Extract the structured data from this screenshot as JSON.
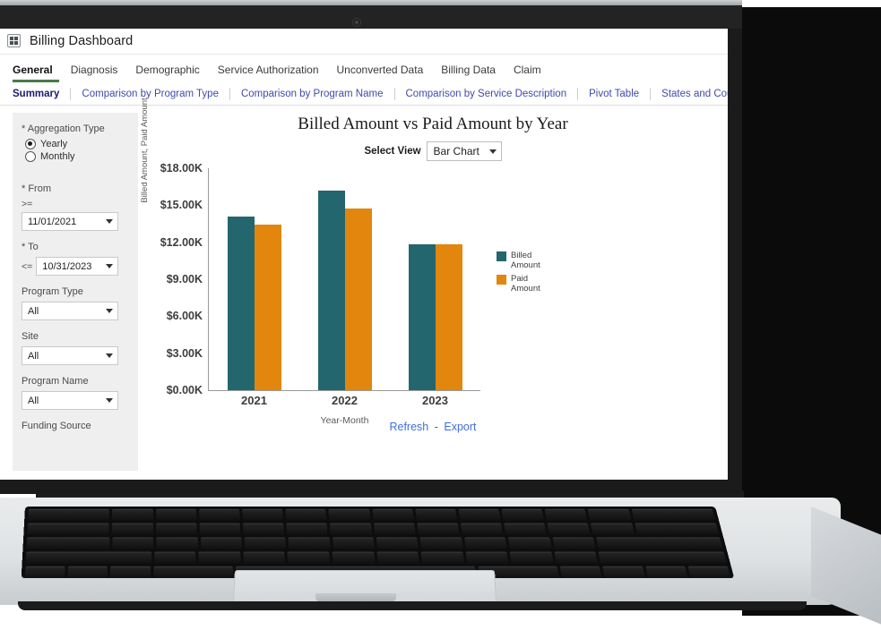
{
  "window": {
    "title": "Billing Dashboard",
    "app_icon": "grid-icon"
  },
  "primary_tabs": [
    {
      "label": "General",
      "active": true
    },
    {
      "label": "Diagnosis",
      "active": false
    },
    {
      "label": "Demographic",
      "active": false
    },
    {
      "label": "Service Authorization",
      "active": false
    },
    {
      "label": "Unconverted Data",
      "active": false
    },
    {
      "label": "Billing Data",
      "active": false
    },
    {
      "label": "Claim",
      "active": false
    }
  ],
  "secondary_tabs": [
    {
      "label": "Summary",
      "active": true
    },
    {
      "label": "Comparison by Program Type",
      "active": false
    },
    {
      "label": "Comparison by Program Name",
      "active": false
    },
    {
      "label": "Comparison by Service Description",
      "active": false
    },
    {
      "label": "Pivot Table",
      "active": false
    },
    {
      "label": "States and Counties",
      "active": false
    }
  ],
  "sidebar": {
    "aggregation": {
      "label": "* Aggregation Type",
      "options": [
        {
          "label": "Yearly",
          "selected": true
        },
        {
          "label": "Monthly",
          "selected": false
        }
      ]
    },
    "from": {
      "label": "* From",
      "operator": ">=",
      "value": "11/01/2021"
    },
    "to": {
      "label": "* To",
      "operator": "<=",
      "value": "10/31/2023"
    },
    "program_type": {
      "label": "Program Type",
      "value": "All"
    },
    "site": {
      "label": "Site",
      "value": "All"
    },
    "program_name": {
      "label": "Program Name",
      "value": "All"
    },
    "funding_source": {
      "label": "Funding Source"
    }
  },
  "view_selector": {
    "label": "Select View",
    "value": "Bar Chart"
  },
  "footer": {
    "refresh": "Refresh",
    "separator": "-",
    "export": "Export"
  },
  "colors": {
    "billed": "#24666e",
    "paid": "#e2860e",
    "link": "#3f6fd8",
    "tab_active_underline": "#4a7a4a"
  },
  "chart_data": {
    "type": "bar",
    "title": "Billed Amount vs Paid Amount by Year",
    "categories": [
      "2021",
      "2022",
      "2023"
    ],
    "series": [
      {
        "name": "Billed Amount",
        "color": "#24666e",
        "values": [
          14050,
          16200,
          11850
        ]
      },
      {
        "name": "Paid Amount",
        "color": "#e2860e",
        "values": [
          13400,
          14700,
          11850
        ]
      }
    ],
    "legend": [
      "Billed Amount",
      "Paid Amount"
    ],
    "legend_position": "right",
    "xlabel": "Year-Month",
    "ylabel": "Billed Amount, Paid Amount",
    "ylim": [
      0,
      18000
    ],
    "ytick_values": [
      0,
      3000,
      6000,
      9000,
      12000,
      15000,
      18000
    ],
    "ytick_labels": [
      "$0.00K",
      "$3.00K",
      "$6.00K",
      "$9.00K",
      "$12.00K",
      "$15.00K",
      "$18.00K"
    ],
    "grid": false
  }
}
